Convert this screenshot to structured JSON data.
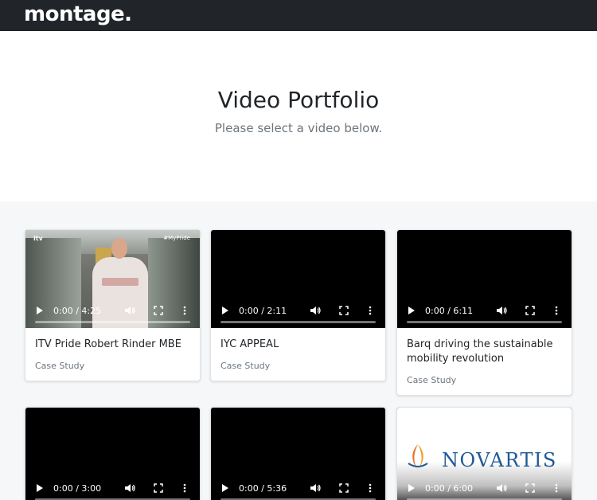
{
  "navbar": {
    "logo": "montage."
  },
  "hero": {
    "title": "Video Portfolio",
    "subtitle": "Please select a video below."
  },
  "videos": [
    {
      "title": "ITV Pride Robert Rinder MBE",
      "category": "Case Study",
      "time": "0:00 / 4:25",
      "thumbnail": "itv-person",
      "thumb_badge_left": "itv",
      "thumb_badge_right": "#MyPride"
    },
    {
      "title": "IYC APPEAL",
      "category": "Case Study",
      "time": "0:00 / 2:11",
      "thumbnail": "black"
    },
    {
      "title": "Barq driving the sustainable mobility revolution",
      "category": "Case Study",
      "time": "0:00 / 6:11",
      "thumbnail": "black"
    },
    {
      "title": "",
      "category": "",
      "time": "0:00 / 3:00",
      "thumbnail": "black"
    },
    {
      "title": "",
      "category": "",
      "time": "0:00 / 5:36",
      "thumbnail": "black"
    },
    {
      "title": "",
      "category": "",
      "time": "0:00 / 6:00",
      "thumbnail": "novartis",
      "logo_text": "NOVARTIS"
    }
  ],
  "icons": {
    "play": "play-icon",
    "volume": "volume-icon",
    "fullscreen": "fullscreen-icon",
    "more": "more-vertical-icon"
  },
  "colors": {
    "navbar": "#212529",
    "background": "#f6f7f9",
    "novartis_blue": "#1f5a96",
    "novartis_orange": "#e8742b"
  }
}
